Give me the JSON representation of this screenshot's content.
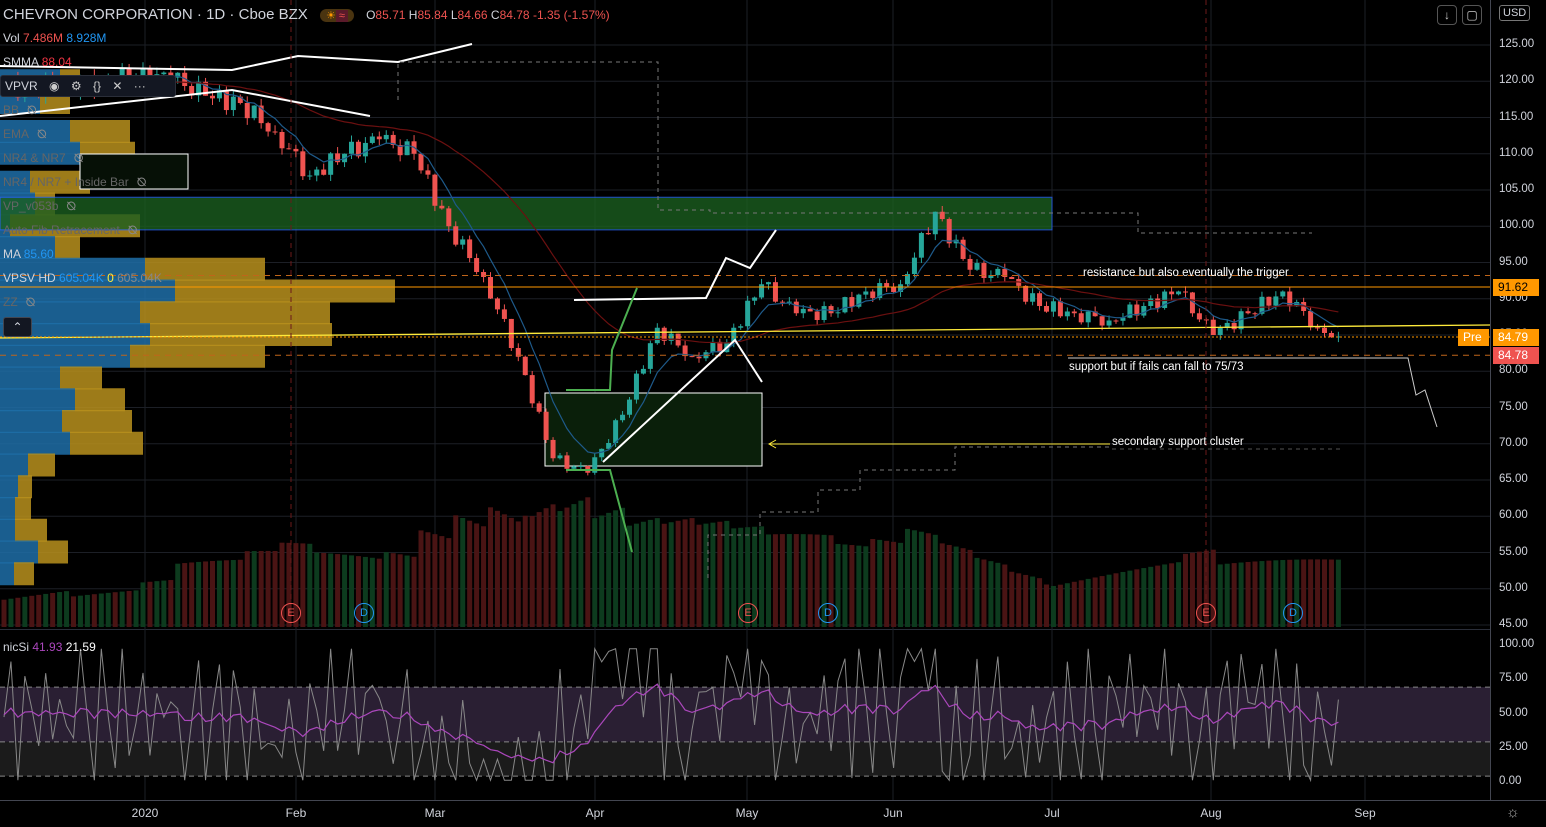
{
  "header": {
    "symbol": "CHEVRON CORPORATION",
    "interval": "1D",
    "exchange": "Cboe BZX",
    "o_label": "O",
    "o": "85.71",
    "h_label": "H",
    "h": "85.84",
    "l_label": "L",
    "l": "84.66",
    "c_label": "C",
    "c": "84.78",
    "change": "-1.35 (-1.57%)"
  },
  "legends": {
    "vol": "Vol",
    "vol_a": "7.486M",
    "vol_b": "8.928M",
    "smma": "SMMA",
    "smma_val": "88.04",
    "vpvr": "VPVR",
    "bb": "BB",
    "ema": "EMA",
    "nr": "NR4 & NR7",
    "nr_inside": "NR4 / NR7 + Inside Bar",
    "vp": "VP_v053b",
    "fib": "Auto Fib Retracement",
    "ma": "MA",
    "ma_val": "85.60",
    "vpsv": "VPSV HD",
    "vpsv_a": "605.04K",
    "vpsv_b": "0",
    "vpsv_c": "605.04K",
    "zz": "ZZ"
  },
  "currency": "USD",
  "price_labels": {
    "resistance": "91.62",
    "pre_label": "Pre",
    "pre": "84.79",
    "last": "84.78"
  },
  "annotations": {
    "resistance": "resistance but also eventually the trigger",
    "support": "support but if fails can fall to 75/73",
    "secondary": "secondary support cluster"
  },
  "events": [
    {
      "t": "E"
    },
    {
      "t": "D"
    },
    {
      "t": "E"
    },
    {
      "t": "D"
    },
    {
      "t": "E"
    },
    {
      "t": "D"
    }
  ],
  "oscillator": {
    "name": "nicSi",
    "v1": "41.93",
    "v2": "21.59",
    "ticks": [
      "100.00",
      "75.00",
      "50.00",
      "25.00",
      "0.00"
    ]
  },
  "colors": {
    "up": "#26a69a",
    "down": "#ef5350",
    "accent": "#ff9800",
    "zone": "#1b5e20",
    "vpvr_up": "#1e6fa8",
    "vpvr_down": "#b8901d"
  },
  "chart_data": {
    "type": "candlestick",
    "title": "CHEVRON CORPORATION · 1D · Cboe BZX",
    "ylim": [
      45,
      125
    ],
    "y_ticks": [
      "125.00",
      "120.00",
      "115.00",
      "110.00",
      "105.00",
      "100.00",
      "95.00",
      "90.00",
      "85.00",
      "80.00",
      "75.00",
      "70.00",
      "65.00",
      "60.00",
      "55.00",
      "50.00",
      "45.00"
    ],
    "x_ticks": [
      "2020",
      "Feb",
      "Mar",
      "Apr",
      "May",
      "Jun",
      "Jul",
      "Aug",
      "Sep"
    ],
    "weekly_close": [
      119,
      119.5,
      120,
      120.5,
      120.5,
      118,
      117,
      113,
      107,
      110,
      112,
      110,
      100,
      93,
      82,
      68,
      66,
      74,
      86,
      82,
      84,
      92,
      88,
      88,
      91,
      92,
      102,
      94,
      93,
      89,
      88,
      87,
      89,
      91,
      85,
      88,
      91,
      86,
      84.8
    ],
    "weekly_volume_m": [
      6,
      6,
      5,
      5,
      6,
      8,
      8,
      9,
      10,
      9,
      9,
      10,
      14,
      18,
      22,
      24,
      22,
      18,
      15,
      14,
      13,
      12,
      11,
      11,
      10,
      11,
      13,
      12,
      11,
      10,
      9,
      9,
      9,
      9,
      10,
      8,
      8,
      8,
      8
    ],
    "volume_profile": [
      {
        "p": 120,
        "up": 60,
        "dn": 20
      },
      {
        "p": 117,
        "up": 40,
        "dn": 30
      },
      {
        "p": 113,
        "up": 70,
        "dn": 60
      },
      {
        "p": 110,
        "up": 80,
        "dn": 55
      },
      {
        "p": 106,
        "up": 30,
        "dn": 60
      },
      {
        "p": 103,
        "up": 35,
        "dn": 20
      },
      {
        "p": 100,
        "up": 10,
        "dn": 130
      },
      {
        "p": 97,
        "up": 55,
        "dn": 25
      },
      {
        "p": 94,
        "up": 145,
        "dn": 120
      },
      {
        "p": 91,
        "up": 175,
        "dn": 220
      },
      {
        "p": 88,
        "up": 140,
        "dn": 190
      },
      {
        "p": 85,
        "up": 150,
        "dn": 182
      },
      {
        "p": 82,
        "up": 130,
        "dn": 135
      },
      {
        "p": 79,
        "up": 60,
        "dn": 42
      },
      {
        "p": 76,
        "up": 75,
        "dn": 50
      },
      {
        "p": 73,
        "up": 62,
        "dn": 70
      },
      {
        "p": 70,
        "up": 70,
        "dn": 73
      },
      {
        "p": 67,
        "up": 28,
        "dn": 27
      },
      {
        "p": 64,
        "up": 18,
        "dn": 14
      },
      {
        "p": 61,
        "up": 15,
        "dn": 16
      },
      {
        "p": 58,
        "up": 15,
        "dn": 32
      },
      {
        "p": 55,
        "up": 38,
        "dn": 30
      },
      {
        "p": 52,
        "up": 14,
        "dn": 20
      }
    ],
    "levels": {
      "resistance": 91.62,
      "resistance_dashed": 93.2,
      "support": 82.2,
      "secondary_support": 70,
      "zone": [
        99.5,
        104
      ]
    }
  }
}
